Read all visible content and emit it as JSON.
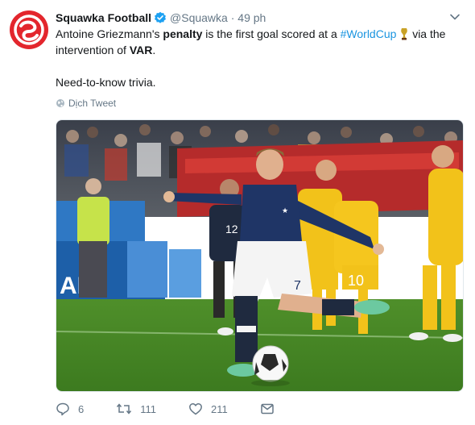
{
  "tweet": {
    "author_name": "Squawka Football",
    "handle": "@Squawka",
    "separator": "·",
    "time": "49 ph",
    "text_pre": "Antoine Griezmann's ",
    "text_bold1": "penalty",
    "text_mid": " is the first goal scored at a ",
    "hashtag": "#WorldCup",
    "text_post": " via the intervention of ",
    "text_bold2": "VAR",
    "text_end": ".",
    "text_line2": "Need-to-know trivia.",
    "translate_label": "Dịch Tweet"
  },
  "image": {
    "banner_text": "AI",
    "player_number": "7",
    "opponent_number_1": "10",
    "opponent_number_2": "12"
  },
  "actions": {
    "replies": "6",
    "retweets": "111",
    "likes": "211"
  },
  "colors": {
    "brand_red": "#e3262d",
    "link_blue": "#1b95e0",
    "muted": "#657786",
    "verified_blue": "#1da1f2"
  },
  "icons": [
    "squawka-logo",
    "verified-badge-icon",
    "chevron-down-icon",
    "globe-icon",
    "reply-icon",
    "retweet-icon",
    "like-icon",
    "dm-icon"
  ]
}
